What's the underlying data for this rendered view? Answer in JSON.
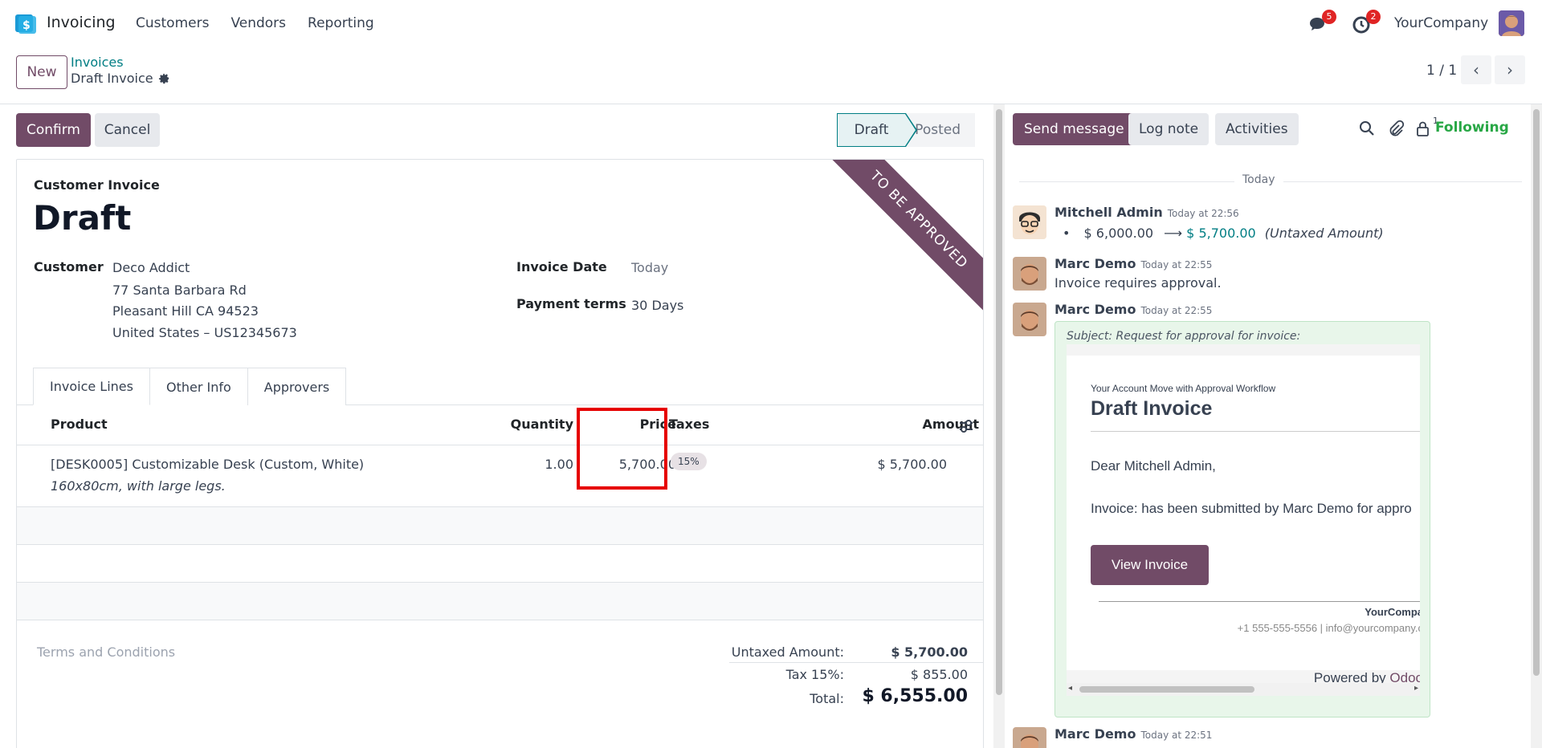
{
  "topnav": {
    "app_name": "Invoicing",
    "menu": [
      "Customers",
      "Vendors",
      "Reporting"
    ],
    "messages_badge": "5",
    "activities_badge": "2",
    "company": "YourCompany"
  },
  "control": {
    "new_label": "New",
    "breadcrumb_parent": "Invoices",
    "breadcrumb_current": "Draft Invoice",
    "pager": "1 / 1"
  },
  "form": {
    "confirm_label": "Confirm",
    "cancel_label": "Cancel",
    "status": [
      "Draft",
      "Posted"
    ],
    "ribbon": "TO BE APPROVED",
    "invoice_type": "Customer Invoice",
    "invoice_name": "Draft",
    "customer_label": "Customer",
    "customer_name": "Deco Addict",
    "customer_address": [
      "77 Santa Barbara Rd",
      "Pleasant Hill CA 94523",
      "United States – US12345673"
    ],
    "invoice_date_label": "Invoice Date",
    "invoice_date_value": "Today",
    "payment_terms_label": "Payment terms",
    "payment_terms_value": "30 Days",
    "tabs": [
      "Invoice Lines",
      "Other Info",
      "Approvers"
    ],
    "columns": {
      "product": "Product",
      "quantity": "Quantity",
      "price": "Price",
      "taxes": "Taxes",
      "amount": "Amount"
    },
    "line": {
      "product": "[DESK0005] Customizable Desk (Custom, White)",
      "description": "160x80cm, with large legs.",
      "quantity": "1.00",
      "price": "5,700.00",
      "tax": "15%",
      "amount": "$ 5,700.00"
    },
    "terms_placeholder": "Terms and Conditions",
    "totals": {
      "untaxed_label": "Untaxed Amount:",
      "untaxed_value": "$ 5,700.00",
      "tax_label": "Tax 15%:",
      "tax_value": "$ 855.00",
      "total_label": "Total:",
      "total_value": "$ 6,555.00"
    }
  },
  "chatter": {
    "send_message": "Send message",
    "log_note": "Log note",
    "activities": "Activities",
    "followers_count": "1",
    "following": "Following",
    "today": "Today",
    "messages": [
      {
        "author": "Mitchell Admin",
        "date": "Today at 22:56",
        "old_value": "$ 6,000.00",
        "new_value": "$ 5,700.00",
        "field": "(Untaxed Amount)"
      },
      {
        "author": "Marc Demo",
        "date": "Today at 22:55",
        "body": "Invoice requires approval."
      },
      {
        "author": "Marc Demo",
        "date": "Today at 22:55"
      },
      {
        "author": "Marc Demo",
        "date": "Today at 22:51"
      }
    ],
    "mail": {
      "subject": "Subject: Request for approval for invoice:",
      "header_small": "Your Account Move with Approval Workflow",
      "title": "Draft Invoice",
      "greeting": "Dear Mitchell Admin,",
      "text": "Invoice: has been submitted by Marc Demo for appro",
      "button": "View Invoice",
      "company": "YourCompa",
      "contact": "+1 555-555-5556 | info@yourcompany.c",
      "powered_prefix": "Powered by ",
      "powered_link": "Odoo"
    }
  },
  "colors": {
    "brand": "#714b67",
    "teal": "#017e84",
    "following": "#28a745",
    "badge": "#e02424",
    "highlight": "#e60000"
  }
}
